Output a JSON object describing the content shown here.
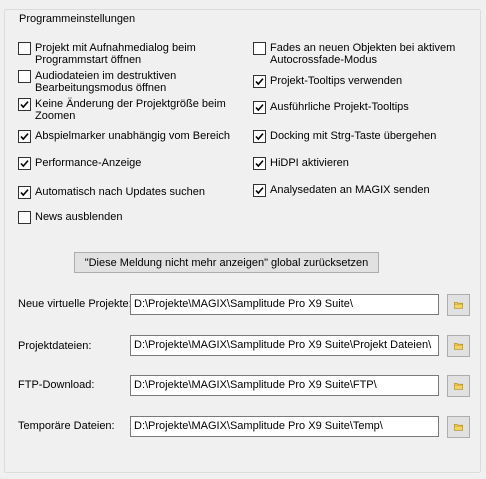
{
  "group": {
    "title": "Programmeinstellungen"
  },
  "options_left": [
    {
      "label": "Projekt mit Aufnahmedialog beim Programmstart öffnen",
      "checked": false
    },
    {
      "label": "Audiodateien im destruktiven Bearbeitungsmodus öffnen",
      "checked": false
    },
    {
      "label": "Keine Änderung der Projektgröße beim Zoomen",
      "checked": true
    },
    {
      "label": "Abspielmarker unabhängig vom Bereich",
      "checked": true
    },
    {
      "label": "Performance-Anzeige",
      "checked": true
    },
    {
      "label": "Automatisch nach Updates suchen",
      "checked": true
    },
    {
      "label": "News ausblenden",
      "checked": false
    }
  ],
  "options_right": [
    {
      "label": "Fades an neuen Objekten bei aktivem Autocrossfade-Modus",
      "checked": false
    },
    {
      "label": "Projekt-Tooltips verwenden",
      "checked": true
    },
    {
      "label": "Ausführliche Projekt-Tooltips",
      "checked": true
    },
    {
      "label": "Docking mit Strg-Taste übergehen",
      "checked": true
    },
    {
      "label": "HiDPI aktivieren",
      "checked": true
    },
    {
      "label": "Analysedaten an MAGIX senden",
      "checked": true
    }
  ],
  "reset_button": {
    "label": "\"Diese Meldung nicht mehr anzeigen\" global zurücksetzen"
  },
  "paths": [
    {
      "label": "Neue virtuelle Projekte:",
      "value": "D:\\Projekte\\MAGIX\\Samplitude Pro X9 Suite\\"
    },
    {
      "label": "Projektdateien:",
      "value": "D:\\Projekte\\MAGIX\\Samplitude Pro X9 Suite\\Projekt Dateien\\"
    },
    {
      "label": "FTP-Download:",
      "value": "D:\\Projekte\\MAGIX\\Samplitude Pro X9 Suite\\FTP\\"
    },
    {
      "label": "Temporäre Dateien:",
      "value": "D:\\Projekte\\MAGIX\\Samplitude Pro X9 Suite\\Temp\\"
    }
  ],
  "icons": {
    "checkbox_check": "checkmark-icon",
    "browse": "folder-icon"
  },
  "colors": {
    "folder": "#f4d35e",
    "folder_outline": "#b08a20"
  }
}
